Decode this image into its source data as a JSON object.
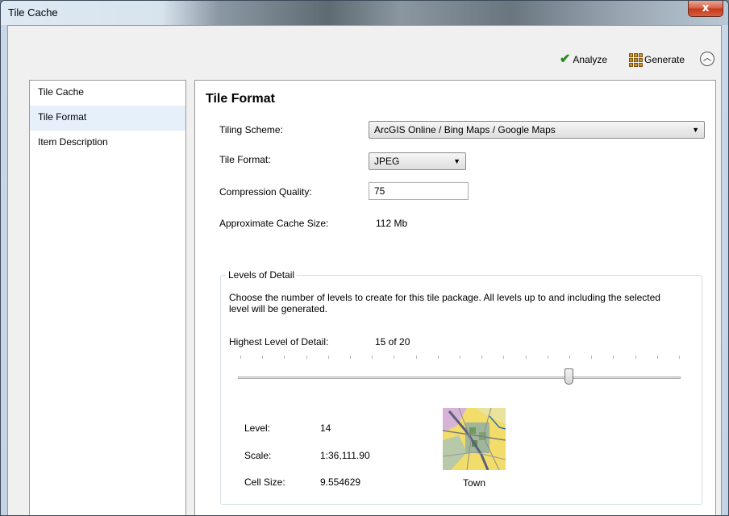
{
  "window": {
    "title": "Tile Cache",
    "close_glyph": "x"
  },
  "toolbar": {
    "analyze_label": "Analyze",
    "generate_label": "Generate"
  },
  "sidebar": {
    "items": [
      {
        "label": "Tile Cache",
        "selected": false
      },
      {
        "label": "Tile Format",
        "selected": true
      },
      {
        "label": "Item Description",
        "selected": false
      }
    ]
  },
  "panel": {
    "heading": "Tile Format",
    "tiling_scheme": {
      "label": "Tiling Scheme:",
      "value": "ArcGIS Online / Bing Maps / Google Maps"
    },
    "tile_format": {
      "label": "Tile Format:",
      "value": "JPEG"
    },
    "compression_quality": {
      "label": "Compression Quality:",
      "value": "75"
    },
    "cache_size": {
      "label": "Approximate Cache Size:",
      "value": "112 Mb"
    },
    "levels": {
      "legend": "Levels of Detail",
      "description": "Choose the number of levels to create for this tile package.   All levels up to and including the selected level will be generated.",
      "highest_label": "Highest Level of Detail:",
      "highest_value": "15 of 20",
      "slider": {
        "current": 15,
        "max": 20
      },
      "level_label": "Level:",
      "level_value": "14",
      "scale_label": "Scale:",
      "scale_value": "1:36,111.90",
      "cellsize_label": "Cell Size:",
      "cellsize_value": "9.554629",
      "thumbnail_caption": "Town"
    }
  },
  "colors": {
    "selected_item_bg": "#e5f0fb",
    "close_button": "#c4381c",
    "check": "#2b8a1e"
  },
  "icons": [
    "checkmark-icon",
    "generate-icon",
    "collapse-up-icon",
    "dropdown-arrow-icon",
    "close-icon"
  ]
}
